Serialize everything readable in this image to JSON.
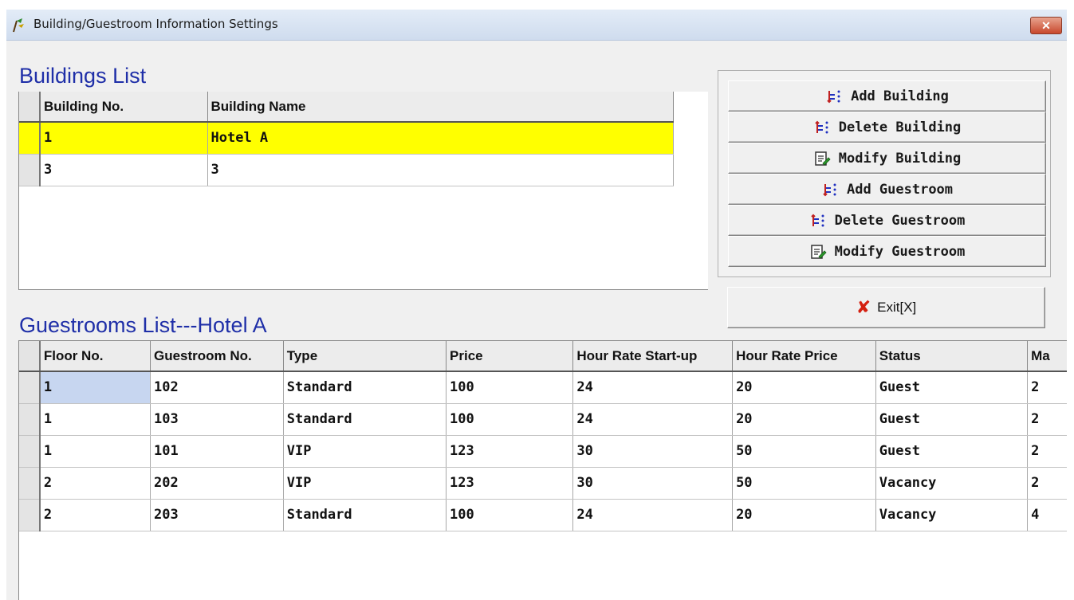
{
  "window": {
    "title": "Building/Guestroom Information Settings",
    "close_label": "✕"
  },
  "buildings": {
    "title": "Buildings List",
    "columns": [
      "Building No.",
      "Building Name"
    ],
    "rows": [
      {
        "no": "1",
        "name": "Hotel A",
        "selected": true
      },
      {
        "no": "3",
        "name": "3",
        "selected": false
      }
    ]
  },
  "actions": {
    "add_building": "Add Building",
    "delete_building": "Delete Building",
    "modify_building": "Modify Building",
    "add_guestroom": "Add Guestroom",
    "delete_guestroom": "Delete Guestroom",
    "modify_guestroom": "Modify Guestroom",
    "exit": "Exit[X]"
  },
  "guestrooms": {
    "title": "Guestrooms List---Hotel A",
    "columns": [
      "Floor No.",
      "Guestroom No.",
      "Type",
      "Price",
      "Hour Rate Start-up",
      "Hour Rate Price",
      "Status",
      "Ma"
    ],
    "rows": [
      [
        "1",
        "102",
        "Standard",
        "100",
        "24",
        "20",
        "Guest",
        "2"
      ],
      [
        "1",
        "103",
        "Standard",
        "100",
        "24",
        "20",
        "Guest",
        "2"
      ],
      [
        "1",
        "101",
        "VIP",
        "123",
        "30",
        "50",
        "Guest",
        "2"
      ],
      [
        "2",
        "202",
        "VIP",
        "123",
        "30",
        "50",
        "Vacancy",
        "2"
      ],
      [
        "2",
        "203",
        "Standard",
        "100",
        "24",
        "20",
        "Vacancy",
        "4"
      ]
    ]
  },
  "colors": {
    "selected_row": "#ffff00",
    "section_title": "#1f2fa8",
    "current_cell": "#c7d6f0"
  }
}
